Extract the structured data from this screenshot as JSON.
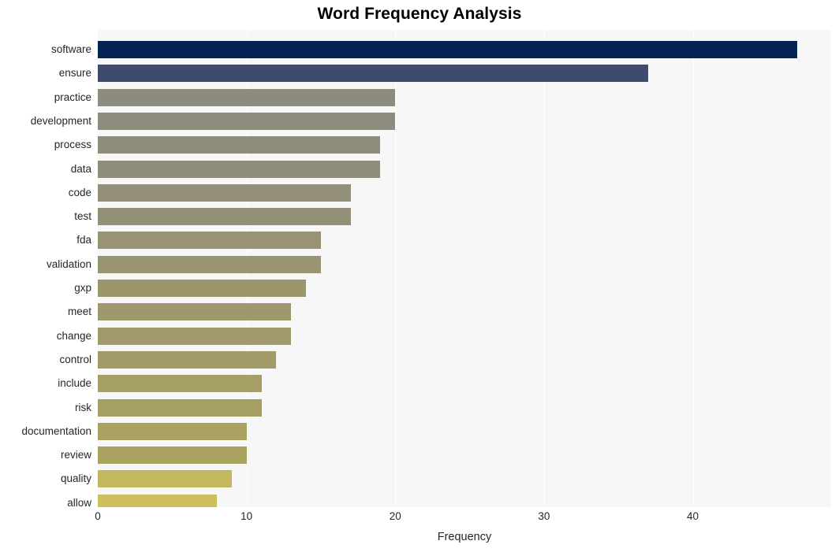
{
  "chart_data": {
    "type": "bar",
    "orientation": "horizontal",
    "title": "Word Frequency Analysis",
    "xlabel": "Frequency",
    "ylabel": "",
    "xlim": [
      0,
      49.3
    ],
    "xticks": [
      0,
      10,
      20,
      30,
      40
    ],
    "xticklabels": [
      "0",
      "10",
      "20",
      "30",
      "40"
    ],
    "grid": true,
    "grid_axis": "x",
    "legend": "none",
    "plot_background": "#f7f7f7",
    "figure_background": "#ffffff",
    "categories": [
      "software",
      "ensure",
      "practice",
      "development",
      "process",
      "data",
      "code",
      "test",
      "fda",
      "validation",
      "gxp",
      "meet",
      "change",
      "control",
      "include",
      "risk",
      "documentation",
      "review",
      "quality",
      "allow"
    ],
    "values": [
      47,
      37,
      20,
      20,
      19,
      19,
      17,
      17,
      15,
      15,
      14,
      13,
      13,
      12,
      11,
      11,
      10,
      10,
      9,
      8
    ],
    "bar_colors": [
      "#042352",
      "#3e4a6e",
      "#8d8b7e",
      "#8e8c7e",
      "#8f8d7c",
      "#908e7b",
      "#938f78",
      "#949077",
      "#989373",
      "#999471",
      "#9c966e",
      "#9e986c",
      "#9f996b",
      "#a29b68",
      "#a59e65",
      "#a69f64",
      "#a9a261",
      "#aaa360",
      "#c3b85f",
      "#cdbe5e"
    ],
    "bars": [
      {
        "label": "software",
        "value": 47,
        "color": "#042352"
      },
      {
        "label": "ensure",
        "value": 37,
        "color": "#3e4a6e"
      },
      {
        "label": "practice",
        "value": 20,
        "color": "#8d8b7e"
      },
      {
        "label": "development",
        "value": 20,
        "color": "#8e8c7e"
      },
      {
        "label": "process",
        "value": 19,
        "color": "#8f8d7c"
      },
      {
        "label": "data",
        "value": 19,
        "color": "#908e7b"
      },
      {
        "label": "code",
        "value": 17,
        "color": "#938f78"
      },
      {
        "label": "test",
        "value": 17,
        "color": "#949077"
      },
      {
        "label": "fda",
        "value": 15,
        "color": "#989373"
      },
      {
        "label": "validation",
        "value": 15,
        "color": "#999471"
      },
      {
        "label": "gxp",
        "value": 14,
        "color": "#9c966e"
      },
      {
        "label": "meet",
        "value": 13,
        "color": "#9e986c"
      },
      {
        "label": "change",
        "value": 13,
        "color": "#9f996b"
      },
      {
        "label": "control",
        "value": 12,
        "color": "#a29b68"
      },
      {
        "label": "include",
        "value": 11,
        "color": "#a59e65"
      },
      {
        "label": "risk",
        "value": 11,
        "color": "#a69f64"
      },
      {
        "label": "documentation",
        "value": 10,
        "color": "#a9a261"
      },
      {
        "label": "review",
        "value": 10,
        "color": "#aaa360"
      },
      {
        "label": "quality",
        "value": 9,
        "color": "#c3b85f"
      },
      {
        "label": "allow",
        "value": 8,
        "color": "#cdbe5e"
      }
    ]
  }
}
